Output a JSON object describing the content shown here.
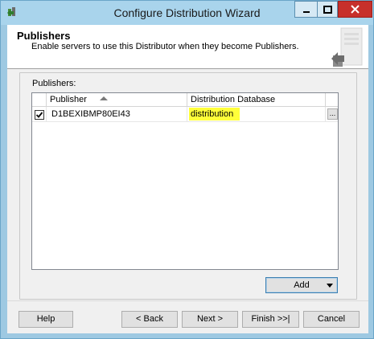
{
  "window": {
    "title": "Configure Distribution Wizard"
  },
  "header": {
    "title": "Publishers",
    "subtitle": "Enable servers to use this Distributor when they become Publishers."
  },
  "publishers": {
    "label": "Publishers:",
    "columns": [
      "Publisher",
      "Distribution Database"
    ],
    "rows": [
      {
        "checked": true,
        "publisher": "D1BEXIBMP80EI43",
        "database": "distribution",
        "ellipsis": "..."
      }
    ],
    "highlight_color": "#ffff3a"
  },
  "add_button": {
    "label": "Add"
  },
  "footer": {
    "help": "Help",
    "back": "< Back",
    "next": "Next >",
    "finish": "Finish >>|",
    "cancel": "Cancel"
  },
  "colors": {
    "titlebar": "#a9d4ec",
    "close_button": "#c7302b"
  }
}
